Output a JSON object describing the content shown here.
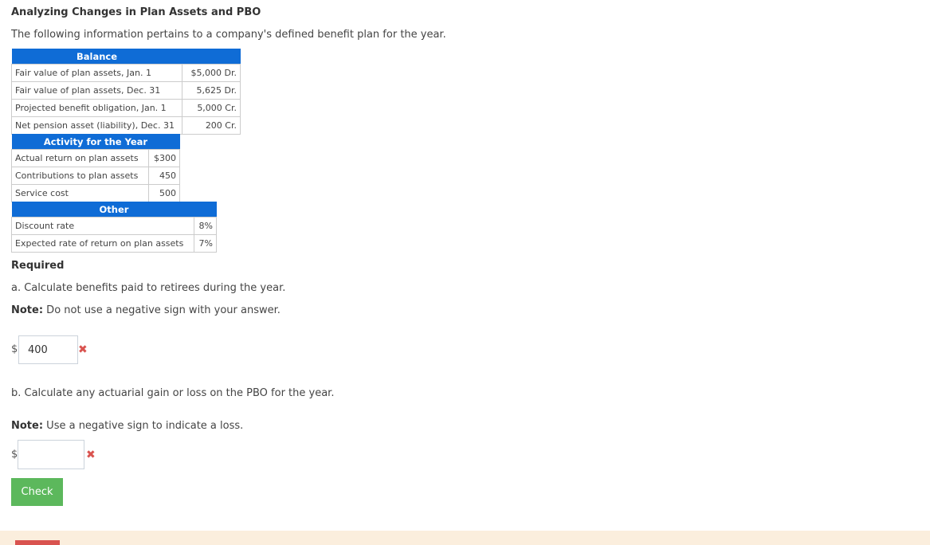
{
  "title": "Analyzing Changes in Plan Assets and PBO",
  "intro": "The following information pertains to a company's defined benefit plan for the year.",
  "balance": {
    "header": "Balance",
    "rows": [
      {
        "label": "Fair value of plan assets, Jan. 1",
        "value": "$5,000 Dr."
      },
      {
        "label": "Fair value of plan assets, Dec. 31",
        "value": "5,625 Dr."
      },
      {
        "label": "Projected benefit obligation, Jan. 1",
        "value": "5,000 Cr."
      },
      {
        "label": "Net pension asset (liability), Dec. 31",
        "value": "200 Cr."
      }
    ]
  },
  "activity": {
    "header": "Activity for the Year",
    "rows": [
      {
        "label": "Actual return on plan assets",
        "value": "$300"
      },
      {
        "label": "Contributions to plan assets",
        "value": "450"
      },
      {
        "label": "Service cost",
        "value": "500"
      }
    ]
  },
  "other": {
    "header": "Other",
    "rows": [
      {
        "label": "Discount rate",
        "value": "8%"
      },
      {
        "label": "Expected rate of return on plan assets",
        "value": "7%"
      }
    ]
  },
  "required_label": "Required",
  "part_a": {
    "question": "a. Calculate benefits paid to retirees during the year.",
    "note_label": "Note:",
    "note_text": " Do not use a negative sign with your answer.",
    "currency": "$",
    "answer": "400",
    "status_icon": "✖"
  },
  "part_b": {
    "question": "b. Calculate any actuarial gain or loss on the PBO for the year.",
    "note_label": "Note:",
    "note_text": " Use a negative sign to indicate a loss.",
    "currency": "$",
    "answer": "",
    "status_icon": "✖"
  },
  "check_label": "Check",
  "colors": {
    "header_blue": "#0f6cd6",
    "check_green": "#5cb85c",
    "error_red": "#d9534f",
    "banner": "#fbeedd"
  }
}
